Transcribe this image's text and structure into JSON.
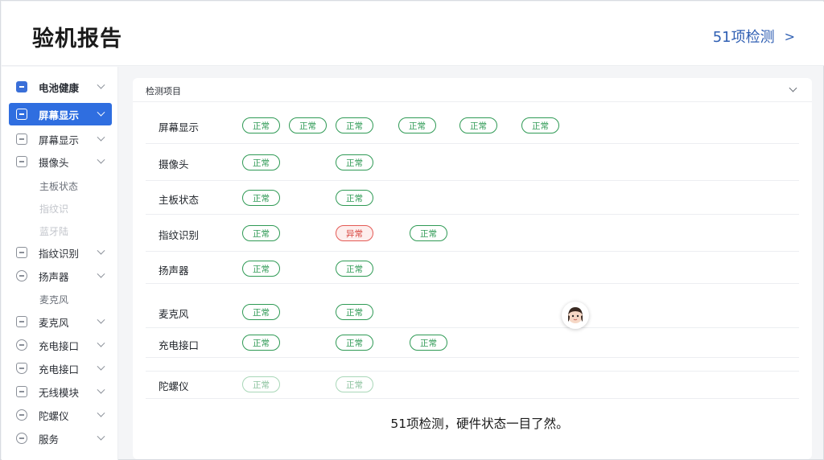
{
  "header": {
    "title": "验机报告",
    "link_label": "51项检测",
    "link_chevron": ">"
  },
  "sidebar": {
    "items": [
      {
        "label": "电池健康",
        "icon": "battery-icon"
      },
      {
        "label": "屏幕显示",
        "icon": "screen-icon",
        "active": true
      },
      {
        "label": "屏幕显示",
        "icon": "screen-icon"
      },
      {
        "label": "摄像头",
        "icon": "camera-icon"
      },
      {
        "label": "主板状态"
      },
      {
        "label": "指纹识别",
        "icon": "fingerprint-icon"
      },
      {
        "label": "扬声器",
        "icon": "speaker-icon"
      },
      {
        "label": "麦克风"
      },
      {
        "label": "麦克风",
        "icon": "mic-icon"
      },
      {
        "label": "充电接口",
        "icon": "charge-icon"
      },
      {
        "label": "充电接口",
        "icon": "shield-icon"
      },
      {
        "label": "无线模块",
        "icon": "wireless-icon"
      },
      {
        "label": "陀螺仪",
        "icon": "gyro-icon"
      },
      {
        "label": "服务",
        "icon": "service-icon"
      }
    ],
    "faded_items": [
      "指纹识",
      "蓝牙陆"
    ]
  },
  "panel": {
    "title": "检测项目",
    "rows": [
      {
        "label": "屏幕显示",
        "statuses": [
          "正常",
          "正常",
          "正常",
          "正常",
          "正常",
          "正常"
        ]
      },
      {
        "label": "摄像头",
        "statuses": [
          "正常",
          "正常"
        ]
      },
      {
        "label": "主板状态",
        "statuses": [
          "正常",
          "正常"
        ]
      },
      {
        "label": "指纹识别",
        "statuses": [
          "正常",
          "异常",
          "正常"
        ]
      },
      {
        "label": "扬声器",
        "statuses": [
          "正常",
          "正常"
        ]
      },
      {
        "label": "麦克风",
        "statuses": [
          "正常",
          "正常"
        ]
      },
      {
        "label": "充电接口",
        "statuses": [
          "正常",
          "正常",
          "正常"
        ]
      },
      {
        "label": "陀螺仪",
        "statuses": [
          "正常",
          "正常"
        ]
      }
    ]
  },
  "caption": "51项检测，硬件状态一目了然。",
  "colors": {
    "accent": "#2f6ee0",
    "link": "#2f5fb3",
    "ok": "#2f9a55",
    "error": "#d8453f"
  }
}
